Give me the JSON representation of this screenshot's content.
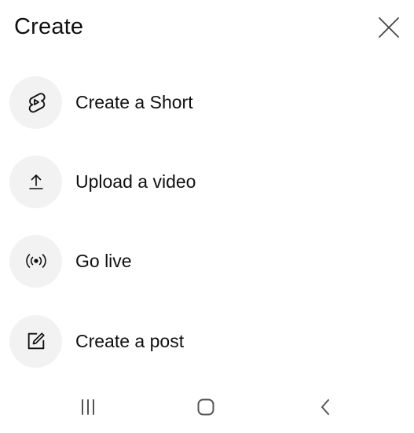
{
  "header": {
    "title": "Create",
    "close_icon": "close-icon"
  },
  "menu": {
    "items": [
      {
        "label": "Create a Short",
        "icon": "shorts-icon"
      },
      {
        "label": "Upload a video",
        "icon": "upload-icon"
      },
      {
        "label": "Go live",
        "icon": "live-broadcast-icon"
      },
      {
        "label": "Create a post",
        "icon": "edit-post-icon"
      }
    ]
  },
  "navbar": {
    "icons": [
      "recent-apps-icon",
      "home-icon",
      "back-icon"
    ]
  },
  "colors": {
    "background": "#ffffff",
    "text": "#0f0f0f",
    "icon_circle_bg": "#f2f2f2",
    "icon_stroke": "#0f0f0f",
    "nav_icon": "#555555"
  }
}
